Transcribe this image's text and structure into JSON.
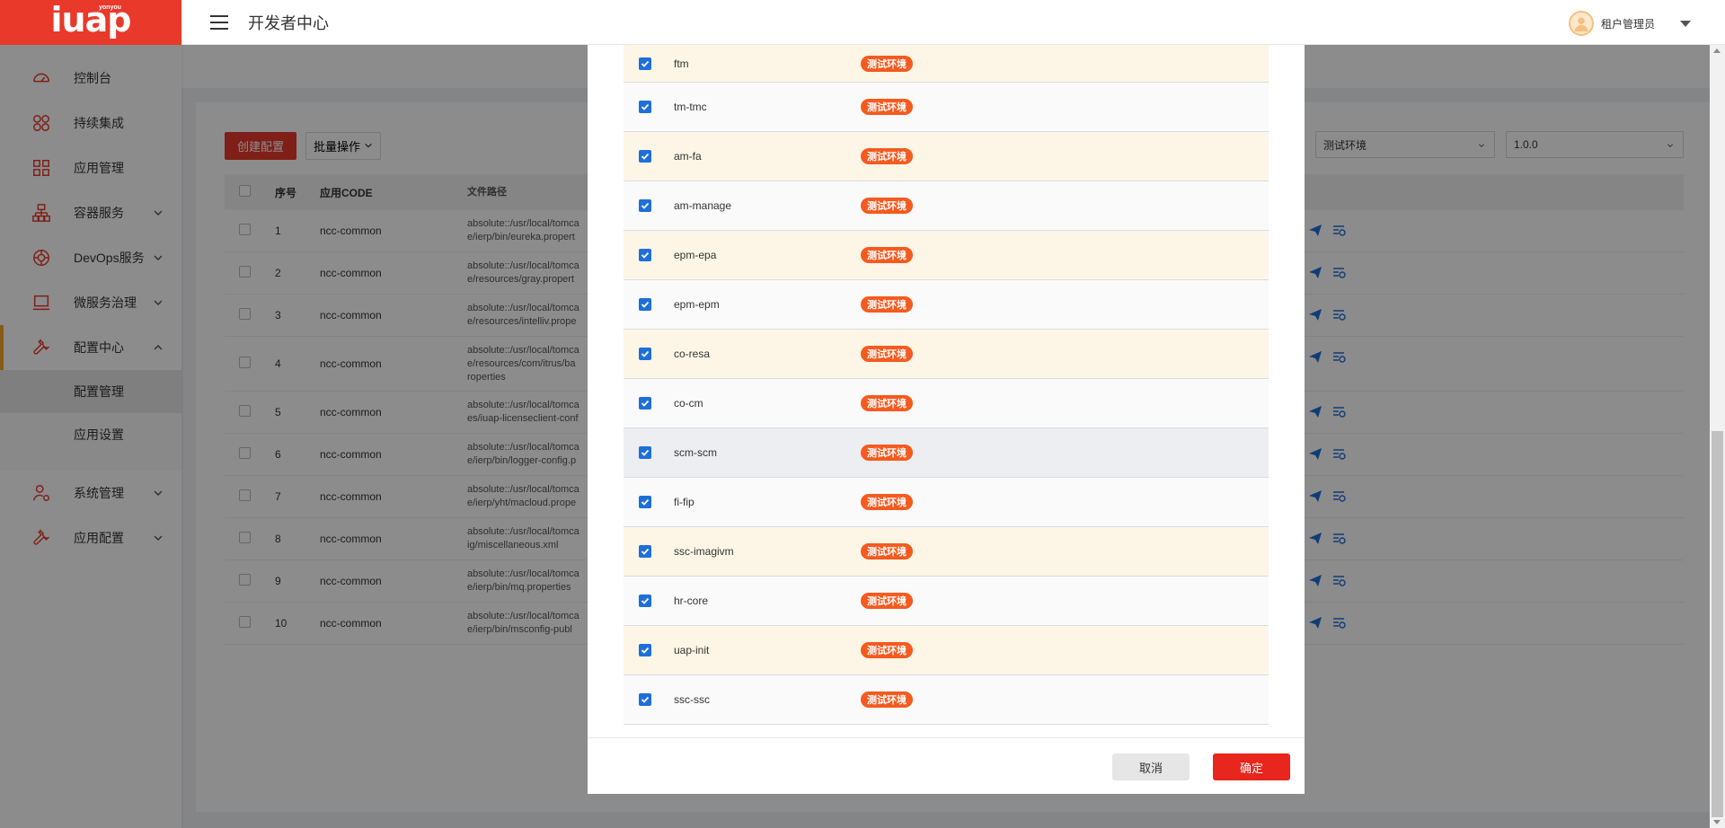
{
  "brand": {
    "logo_text": "iuap",
    "logo_sub": "yonyou"
  },
  "header": {
    "title": "开发者中心",
    "user_name": "租户管理员"
  },
  "sidebar": {
    "items": [
      {
        "label": "控制台",
        "icon": "dashboard-icon"
      },
      {
        "label": "持续集成",
        "icon": "integration-icon"
      },
      {
        "label": "应用管理",
        "icon": "app-grid-icon"
      },
      {
        "label": "容器服务",
        "icon": "container-icon"
      },
      {
        "label": "DevOps服务",
        "icon": "devops-icon"
      },
      {
        "label": "微服务治理",
        "icon": "laptop-icon"
      },
      {
        "label": "配置中心",
        "icon": "wrench-icon"
      },
      {
        "label": "系统管理",
        "icon": "user-gear-icon"
      },
      {
        "label": "应用配置",
        "icon": "wrench-icon"
      }
    ],
    "submenu": [
      {
        "label": "配置管理"
      },
      {
        "label": "应用设置"
      }
    ]
  },
  "toolbar": {
    "create_label": "创建配置",
    "batch_label": "批量操作"
  },
  "filters": {
    "env_value": "测试环境",
    "version_value": "1.0.0"
  },
  "bg_table": {
    "headers": {
      "no": "序号",
      "code": "应用CODE",
      "path": "文件路径"
    },
    "rows": [
      {
        "no": "1",
        "code": "ncc-common",
        "path1": "absolute::/usr/local/tomca",
        "path2": "e/ierp/bin/eureka.propert"
      },
      {
        "no": "2",
        "code": "ncc-common",
        "path1": "absolute::/usr/local/tomca",
        "path2": "e/resources/gray.propert"
      },
      {
        "no": "3",
        "code": "ncc-common",
        "path1": "absolute::/usr/local/tomca",
        "path2": "e/resources/intelliv.prope"
      },
      {
        "no": "4",
        "code": "ncc-common",
        "path1": "absolute::/usr/local/tomca",
        "path2": "e/resources/com/itrus/ba",
        "path3": "roperties"
      },
      {
        "no": "5",
        "code": "ncc-common",
        "path1": "absolute::/usr/local/tomca",
        "path2": "es/iuap-licenseclient-conf"
      },
      {
        "no": "6",
        "code": "ncc-common",
        "path1": "absolute::/usr/local/tomca",
        "path2": "e/ierp/bin/logger-config.p"
      },
      {
        "no": "7",
        "code": "ncc-common",
        "path1": "absolute::/usr/local/tomca",
        "path2": "e/ierp/yht/macloud.prope"
      },
      {
        "no": "8",
        "code": "ncc-common",
        "path1": "absolute::/usr/local/tomca",
        "path2": "ig/miscellaneous.xml"
      },
      {
        "no": "9",
        "code": "ncc-common",
        "path1": "absolute::/usr/local/tomca",
        "path2": "e/ierp/bin/mq.properties"
      },
      {
        "no": "10",
        "code": "ncc-common",
        "path1": "absolute::/usr/local/tomca",
        "path2": "e/ierp/bin/msconfig-publ"
      }
    ]
  },
  "modal": {
    "rows": [
      {
        "name": "ftm",
        "tag": "测试环境"
      },
      {
        "name": "tm-tmc",
        "tag": "测试环境"
      },
      {
        "name": "am-fa",
        "tag": "测试环境"
      },
      {
        "name": "am-manage",
        "tag": "测试环境"
      },
      {
        "name": "epm-epa",
        "tag": "测试环境"
      },
      {
        "name": "epm-epm",
        "tag": "测试环境"
      },
      {
        "name": "co-resa",
        "tag": "测试环境"
      },
      {
        "name": "co-cm",
        "tag": "测试环境"
      },
      {
        "name": "scm-scm",
        "tag": "测试环境"
      },
      {
        "name": "fi-fip",
        "tag": "测试环境"
      },
      {
        "name": "ssc-imagivm",
        "tag": "测试环境"
      },
      {
        "name": "hr-core",
        "tag": "测试环境"
      },
      {
        "name": "uap-init",
        "tag": "测试环境"
      },
      {
        "name": "ssc-ssc",
        "tag": "测试环境"
      }
    ],
    "cancel_label": "取消",
    "ok_label": "确定"
  },
  "colors": {
    "brand": "#e8392a",
    "tag": "#f55a1f",
    "checkbox": "#1e6fd9",
    "active_accent": "#f5a623"
  }
}
